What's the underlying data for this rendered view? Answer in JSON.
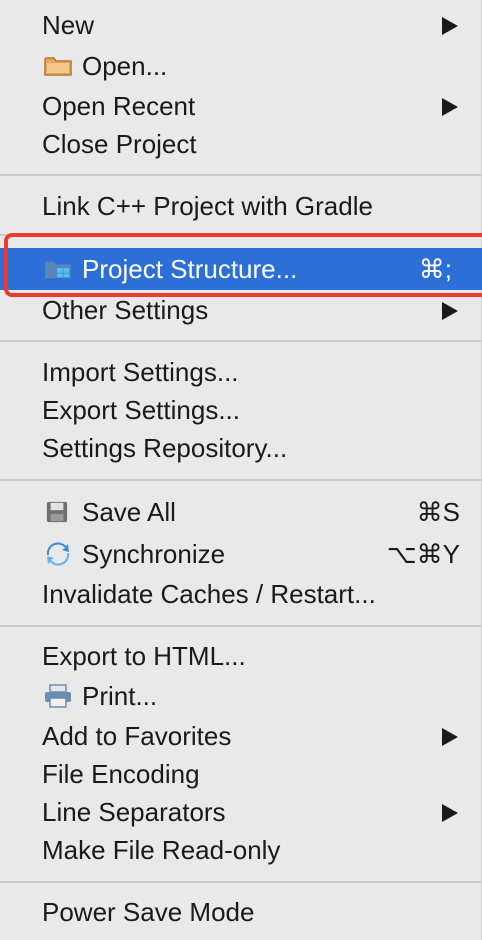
{
  "menu": {
    "new": {
      "label": "New"
    },
    "open": {
      "label": "Open...",
      "icon": "folder-icon"
    },
    "open_recent": {
      "label": "Open Recent"
    },
    "close_project": {
      "label": "Close Project"
    },
    "link_cpp": {
      "label": "Link C++ Project with Gradle"
    },
    "project_structure": {
      "label": "Project Structure...",
      "shortcut": "⌘;",
      "icon": "project-structure-icon",
      "selected": true
    },
    "other_settings": {
      "label": "Other Settings"
    },
    "import_settings": {
      "label": "Import Settings..."
    },
    "export_settings": {
      "label": "Export Settings..."
    },
    "settings_repository": {
      "label": "Settings Repository..."
    },
    "save_all": {
      "label": "Save All",
      "shortcut": "⌘S",
      "icon": "save-icon"
    },
    "synchronize": {
      "label": "Synchronize",
      "shortcut": "⌥⌘Y",
      "icon": "sync-icon"
    },
    "invalidate_caches": {
      "label": "Invalidate Caches / Restart..."
    },
    "export_html": {
      "label": "Export to HTML..."
    },
    "print": {
      "label": "Print...",
      "icon": "printer-icon"
    },
    "add_favorites": {
      "label": "Add to Favorites"
    },
    "file_encoding": {
      "label": "File Encoding"
    },
    "line_separators": {
      "label": "Line Separators"
    },
    "read_only": {
      "label": "Make File Read-only"
    },
    "power_save": {
      "label": "Power Save Mode"
    }
  },
  "colors": {
    "selection": "#2d6fd9",
    "annotation_outline": "#ec3a32",
    "menu_background": "#e9e9e9"
  }
}
